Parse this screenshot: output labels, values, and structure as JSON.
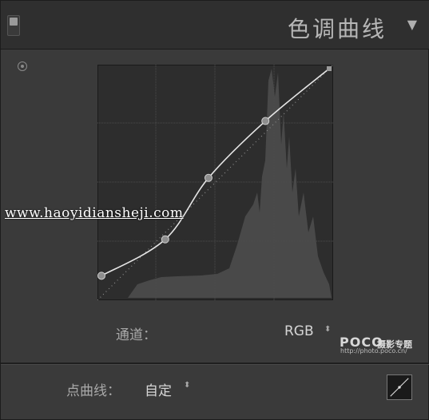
{
  "header": {
    "title": "色调曲线",
    "collapse_icon": "▼"
  },
  "watermark": "www.haoyidiansheji.com",
  "channel": {
    "label": "通道：",
    "value": "RGB"
  },
  "point_curve": {
    "label": "点曲线：",
    "value": "自定"
  },
  "poco": {
    "brand": "POCO",
    "brand_cn": "摄影专题",
    "url": "http://photo.poco.cn/"
  },
  "curve_points": [
    [
      0,
      0.09
    ],
    [
      0.28,
      0.25
    ],
    [
      0.47,
      0.52
    ],
    [
      0.72,
      0.77
    ],
    [
      1.0,
      1.0
    ]
  ],
  "icons": {
    "spinner": "⬍",
    "target": "target-icon",
    "curve": "linear-curve-icon"
  },
  "colors": {
    "panel": "#3a3a3a",
    "graph_bg": "#2c2c2c",
    "curve": "#e6e6e6"
  }
}
